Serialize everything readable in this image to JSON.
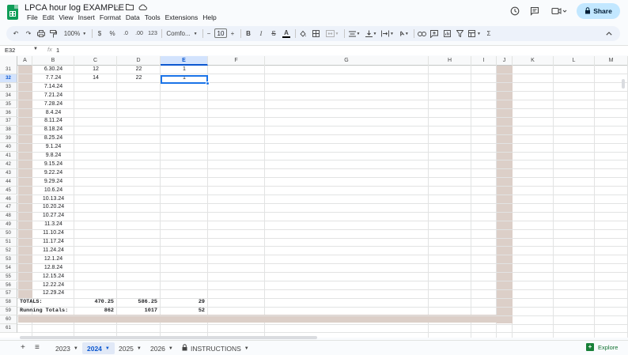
{
  "document": {
    "title": "LPCA hour log EXAMPLE"
  },
  "menu": [
    "File",
    "Edit",
    "View",
    "Insert",
    "Format",
    "Data",
    "Tools",
    "Extensions",
    "Help"
  ],
  "share_label": "Share",
  "toolbar": {
    "zoom": "100%",
    "currency": "$",
    "percent": "%",
    "dec_decrease": ".0",
    "dec_increase": ".00",
    "number_format": "123",
    "font": "Comfo...",
    "font_size": "10"
  },
  "formula_bar": {
    "cell_ref": "E32",
    "fx": "fx",
    "value": "1"
  },
  "columns": [
    "A",
    "B",
    "C",
    "D",
    "E",
    "F",
    "G",
    "H",
    "I",
    "J",
    "K",
    "L",
    "M"
  ],
  "selected_column": "E",
  "selected_row": "32",
  "rows": [
    {
      "num": "31",
      "b": "6.30.24",
      "c": "12",
      "d": "22",
      "e": "1"
    },
    {
      "num": "32",
      "b": "7.7.24",
      "c": "14",
      "d": "22",
      "e": "1"
    },
    {
      "num": "33",
      "b": "7.14.24"
    },
    {
      "num": "34",
      "b": "7.21.24"
    },
    {
      "num": "35",
      "b": "7.28.24"
    },
    {
      "num": "36",
      "b": "8.4.24"
    },
    {
      "num": "37",
      "b": "8.11.24"
    },
    {
      "num": "38",
      "b": "8.18.24"
    },
    {
      "num": "39",
      "b": "8.25.24"
    },
    {
      "num": "40",
      "b": "9.1.24"
    },
    {
      "num": "41",
      "b": "9.8.24"
    },
    {
      "num": "42",
      "b": "9.15.24"
    },
    {
      "num": "43",
      "b": "9.22.24"
    },
    {
      "num": "44",
      "b": "9.29.24"
    },
    {
      "num": "45",
      "b": "10.6.24"
    },
    {
      "num": "46",
      "b": "10.13.24"
    },
    {
      "num": "47",
      "b": "10.20.24"
    },
    {
      "num": "48",
      "b": "10.27.24"
    },
    {
      "num": "49",
      "b": "11.3.24"
    },
    {
      "num": "50",
      "b": "11.10.24"
    },
    {
      "num": "51",
      "b": "11.17.24"
    },
    {
      "num": "52",
      "b": "11.24.24"
    },
    {
      "num": "53",
      "b": "12.1.24"
    },
    {
      "num": "54",
      "b": "12.8.24"
    },
    {
      "num": "55",
      "b": "12.15.24"
    },
    {
      "num": "56",
      "b": "12.22.24"
    },
    {
      "num": "57",
      "b": "12.29.24"
    },
    {
      "num": "58",
      "label": "TOTALS:",
      "c": "470.25",
      "d": "586.25",
      "e": "29"
    },
    {
      "num": "59",
      "label": "Running Totals:",
      "c": "862",
      "d": "1017",
      "e": "52"
    },
    {
      "num": "60"
    },
    {
      "num": "61"
    }
  ],
  "sheets": [
    {
      "name": "2023",
      "active": false
    },
    {
      "name": "2024",
      "active": true
    },
    {
      "name": "2025",
      "active": false
    },
    {
      "name": "2026",
      "active": false
    },
    {
      "name": "INSTRUCTIONS",
      "active": false,
      "locked": true
    }
  ],
  "explore_label": "Explore"
}
